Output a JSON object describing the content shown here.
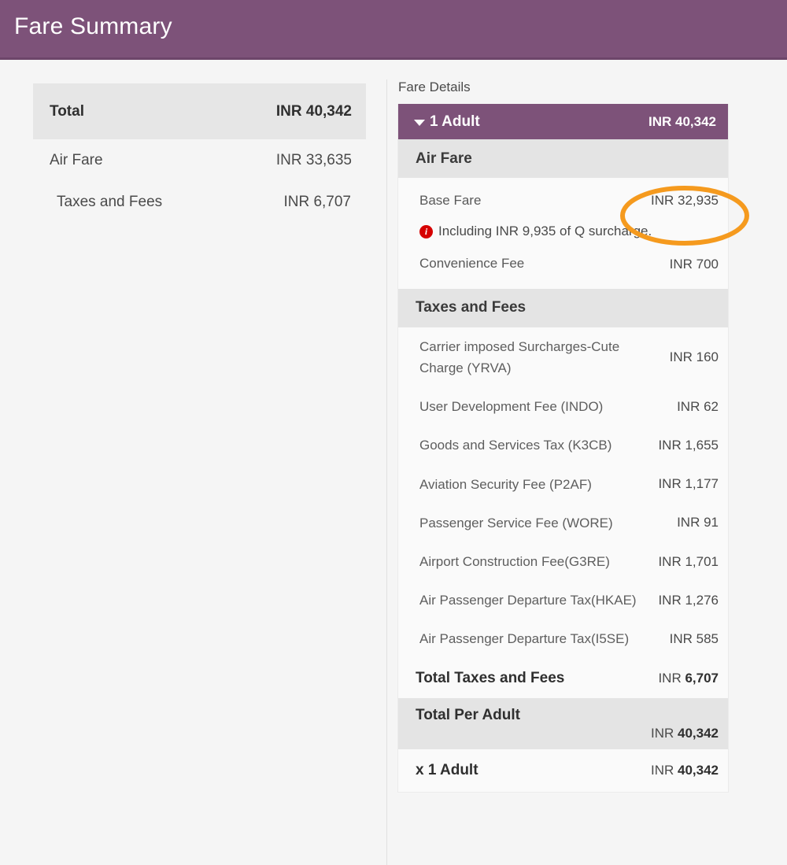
{
  "header": {
    "title": "Fare Summary",
    "background_color": "#7d5279"
  },
  "summary": {
    "total_label": "Total",
    "total_amount": "INR 40,342",
    "rows": [
      {
        "label": "Air Fare",
        "amount": "INR 33,635"
      },
      {
        "label": "Taxes and Fees",
        "amount": "INR 6,707"
      }
    ]
  },
  "details": {
    "caption": "Fare Details",
    "pax_header": {
      "label": "1 Adult",
      "amount": "INR 40,342",
      "caret": "chevron-down-icon"
    },
    "air_fare": {
      "section_title": "Air Fare",
      "base_fare": {
        "label": "Base Fare",
        "amount": "INR 32,935"
      },
      "note": {
        "icon": "info-icon",
        "icon_glyph": "i",
        "icon_color": "#d60000",
        "text": "Including INR 9,935 of Q surcharge."
      },
      "convenience_fee": {
        "label": "Convenience Fee",
        "amount": "INR 700"
      }
    },
    "taxes": {
      "section_title": "Taxes and Fees",
      "rows": [
        {
          "label": "Carrier imposed Surcharges-Cute Charge (YRVA)",
          "amount": "INR 160"
        },
        {
          "label": "User Development Fee (INDO)",
          "amount": "INR 62"
        },
        {
          "label": "Goods and Services Tax (K3CB)",
          "amount": "INR 1,655"
        },
        {
          "label": "Aviation Security Fee (P2AF)",
          "amount": "INR 1,177"
        },
        {
          "label": "Passenger Service Fee (WORE)",
          "amount": "INR 91"
        },
        {
          "label": "Airport Construction Fee(G3RE)",
          "amount": "INR 1,701"
        },
        {
          "label": "Air Passenger Departure Tax(HKAE)",
          "amount": "INR 1,276"
        },
        {
          "label": "Air Passenger Departure Tax(I5SE)",
          "amount": "INR 585"
        }
      ],
      "total_label": "Total Taxes and Fees",
      "total_currency": "INR ",
      "total_value": "6,707"
    },
    "total_per_adult": {
      "label": "Total Per Adult",
      "currency": "INR ",
      "value": "40,342"
    },
    "pax_multiplier": {
      "label": "x 1 Adult",
      "currency": "INR ",
      "value": "40,342"
    }
  },
  "annotation": {
    "name": "highlight-ellipse",
    "color": "#f59a1e",
    "target": "Base Fare amount"
  }
}
